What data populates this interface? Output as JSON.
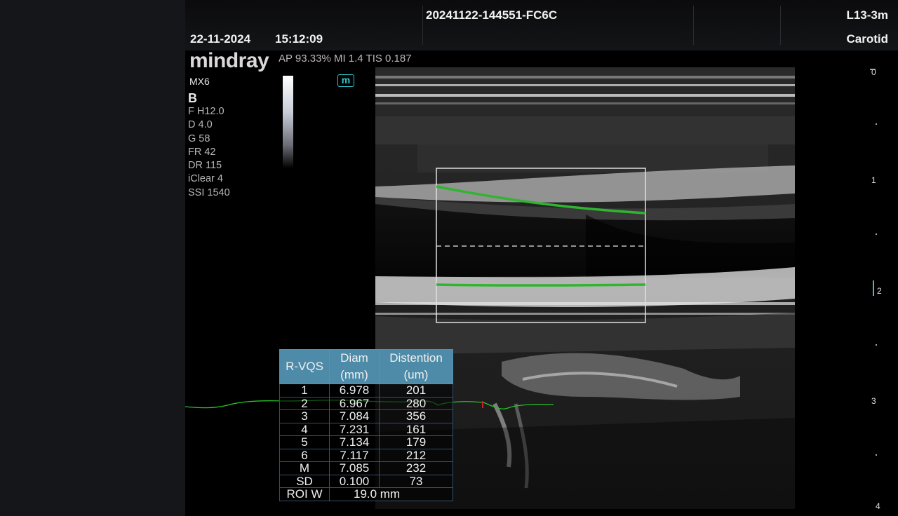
{
  "header": {
    "patient_id": "20241122-144551-FC6C",
    "date": "22-11-2024",
    "time": "15:12:09",
    "probe": "L13-3m",
    "preset": "Carotid"
  },
  "brand": {
    "logo": "mindray",
    "model": "MX6"
  },
  "acoustic": "AP 93.33%   MI 1.4  TIS 0.187",
  "mode": "B",
  "imaging_params": [
    "F H12.0",
    "D 4.0",
    "G 58",
    "FR 42",
    "DR 115",
    "iClear 4",
    "SSI 1540"
  ],
  "m_badge": "m",
  "depth_scale": [
    "0",
    "1",
    "2",
    "3",
    "4"
  ],
  "table": {
    "headers": [
      "R-VQS",
      "Diam\n(mm)",
      "Distention\n(um)"
    ],
    "rows": [
      [
        "1",
        "6.978",
        "201"
      ],
      [
        "2",
        "6.967",
        "280"
      ],
      [
        "3",
        "7.084",
        "356"
      ],
      [
        "4",
        "7.231",
        "161"
      ],
      [
        "5",
        "7.134",
        "179"
      ],
      [
        "6",
        "7.117",
        "212"
      ],
      [
        "M",
        "7.085",
        "232"
      ],
      [
        "SD",
        "0.100",
        "73"
      ]
    ],
    "roi_label": "ROI W",
    "roi_value": "19.0 mm"
  },
  "colors": {
    "trace_green": "#2fb52f",
    "ecg_green": "#27c227",
    "table_header": "#4e8ba8",
    "accent_cyan": "#2ec7d0"
  }
}
